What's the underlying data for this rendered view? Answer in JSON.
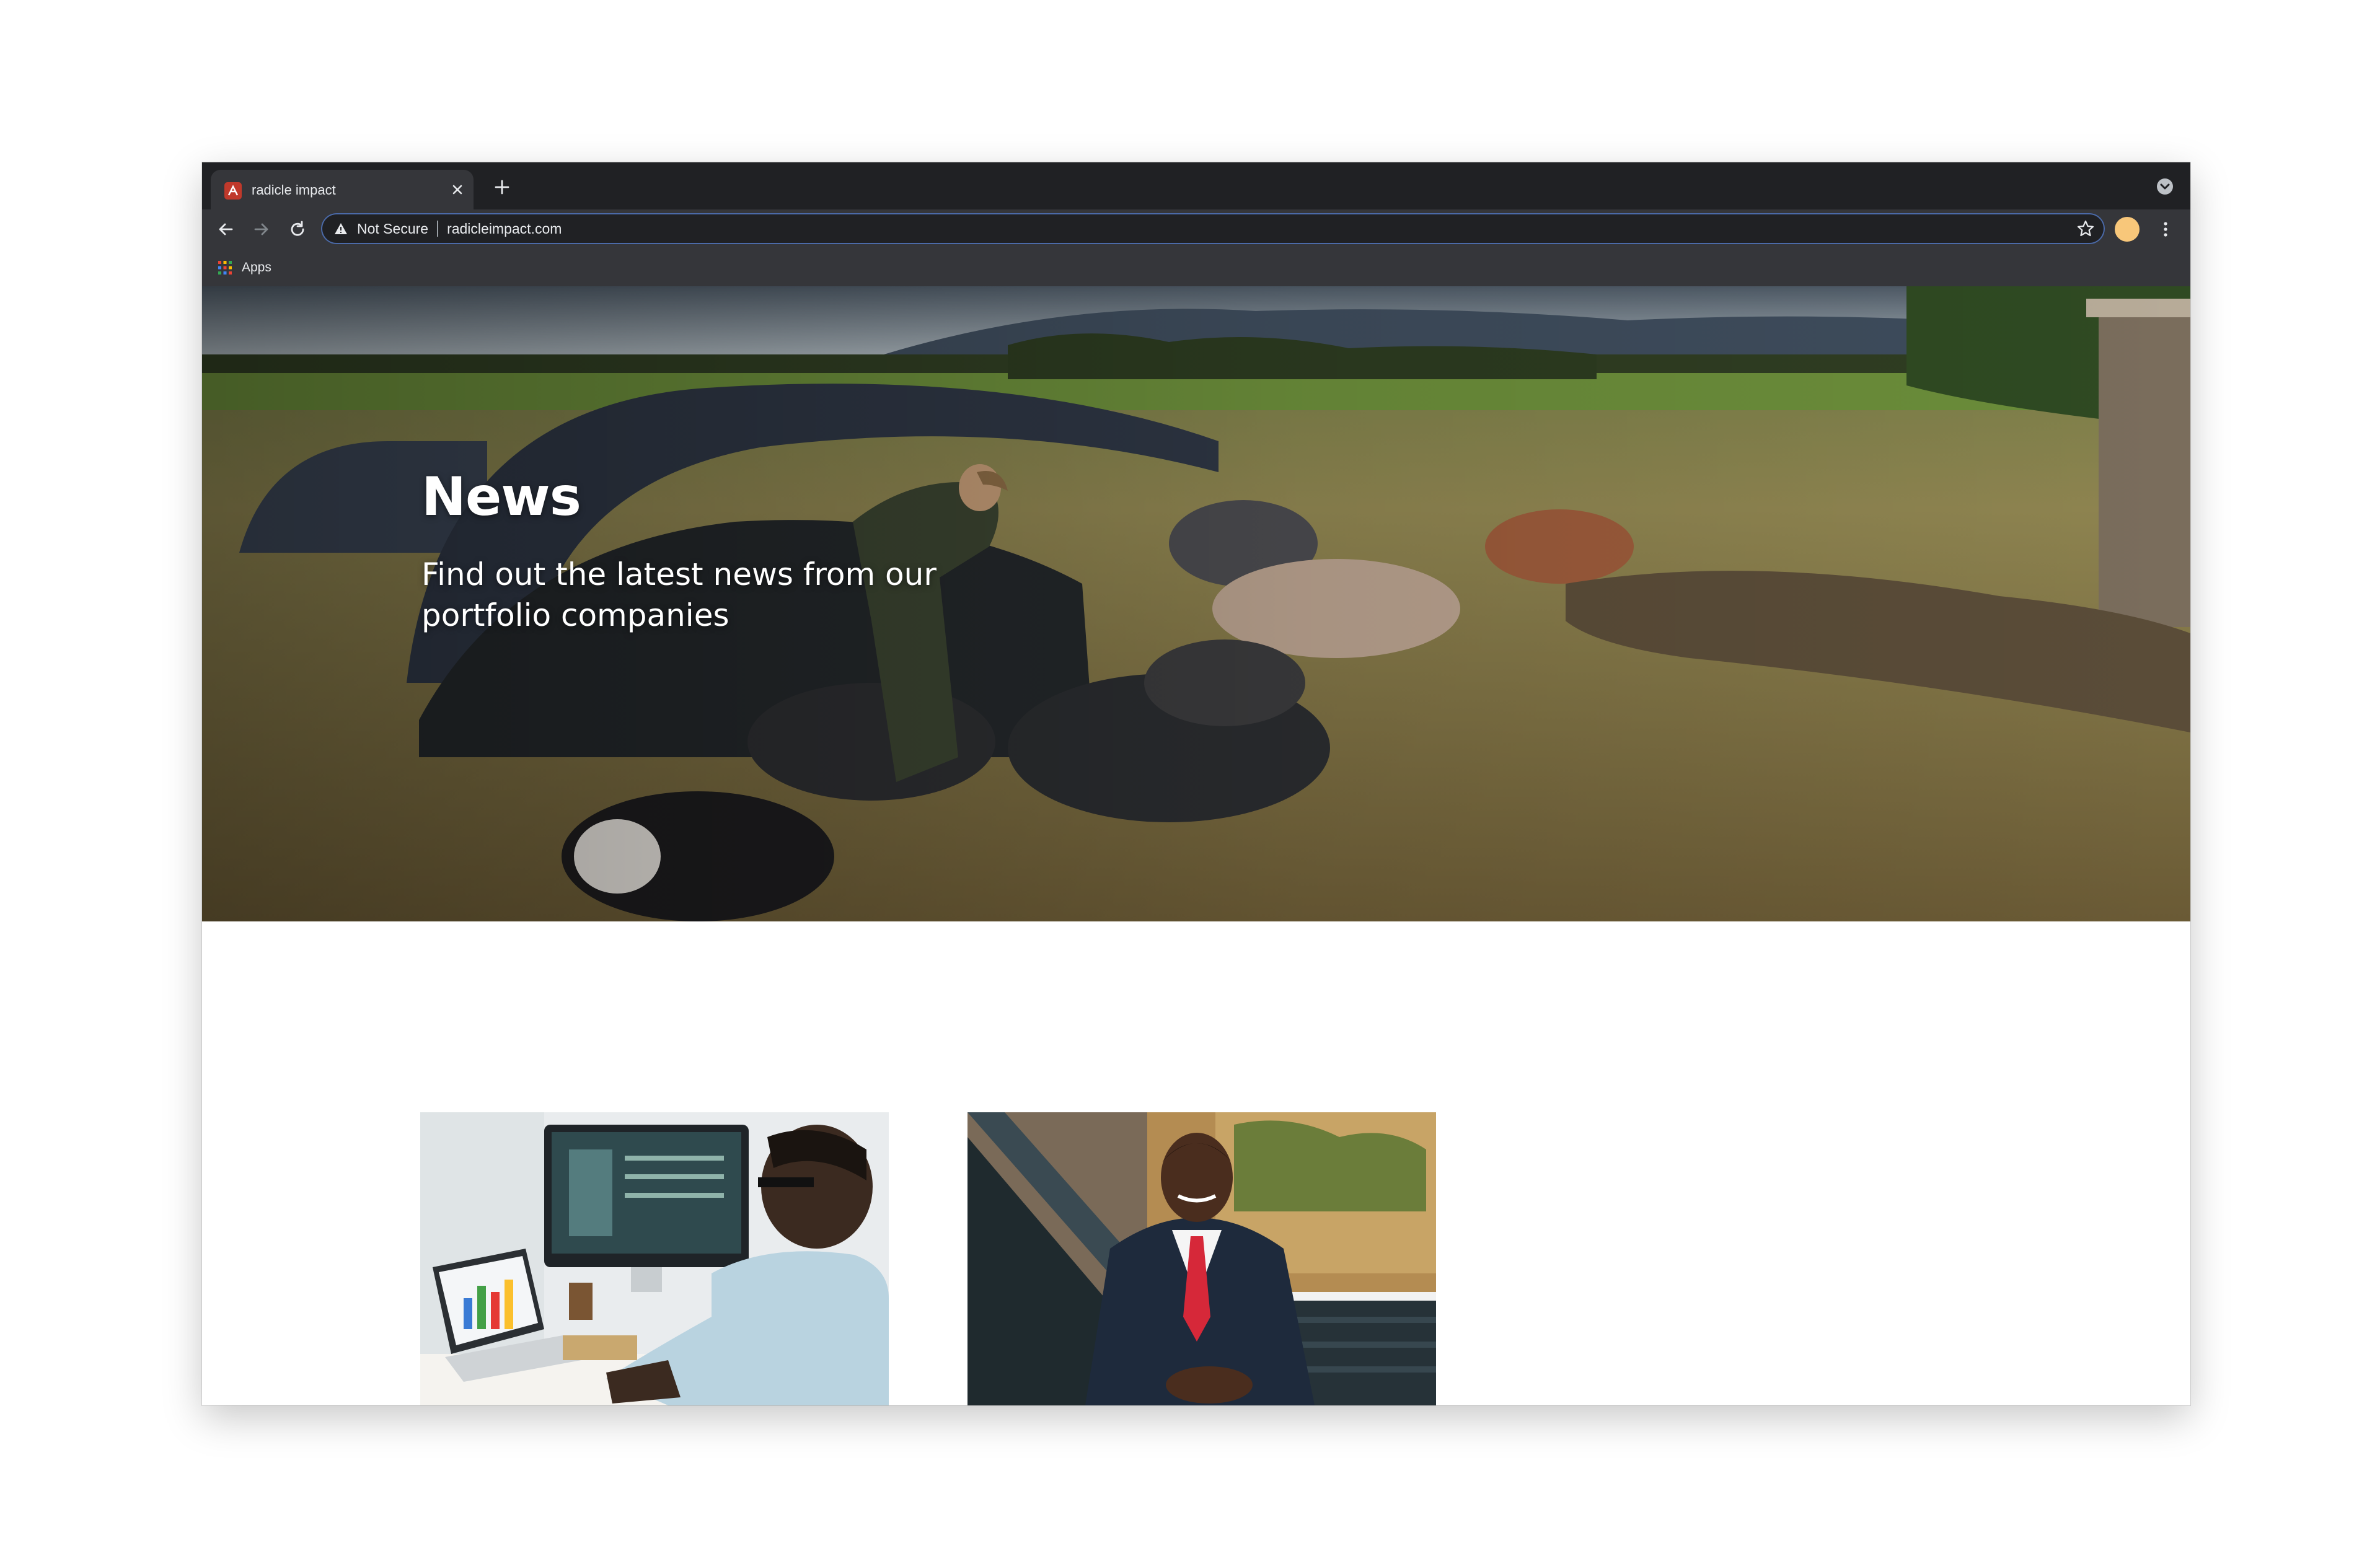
{
  "browser": {
    "tab": {
      "title": "radicle impact",
      "favicon": "radicle-logo-icon"
    },
    "address_bar": {
      "security_label": "Not Secure",
      "url": "radicleimpact.com"
    },
    "bookmarks": [
      {
        "label": "Apps",
        "icon": "apps-grid-icon"
      }
    ],
    "colors": {
      "frame": "#202124",
      "toolbar": "#35363a",
      "text": "#e8eaed",
      "avatar": "#f8c77a"
    }
  },
  "hero": {
    "title": "News",
    "subtitle": "Find out the latest news from our portfolio companies",
    "image": "farm-pigs-photo"
  },
  "news_cards": [
    {
      "image": "office-computer-photo"
    },
    {
      "image": "businessman-portrait-photo"
    }
  ]
}
